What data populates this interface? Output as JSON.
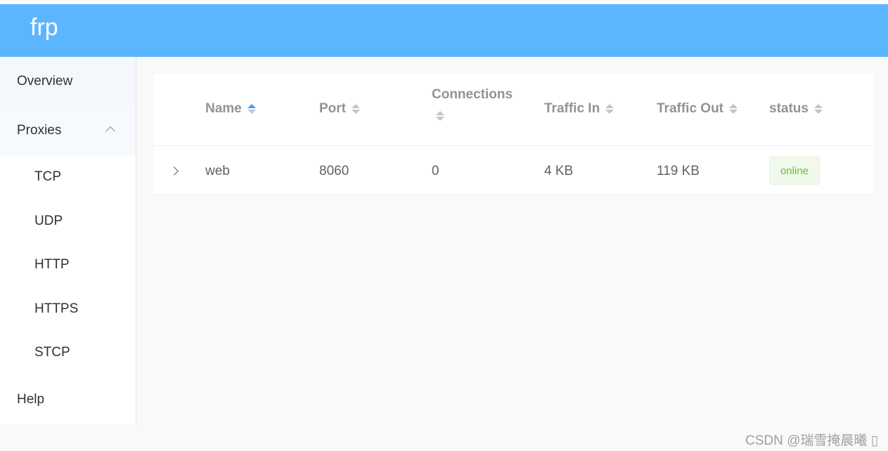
{
  "app": {
    "brand": "frp"
  },
  "sidebar": {
    "overview": "Overview",
    "proxies": "Proxies",
    "submenu": [
      "TCP",
      "UDP",
      "HTTP",
      "HTTPS",
      "STCP"
    ],
    "help": "Help"
  },
  "table": {
    "columns": {
      "name": "Name",
      "port": "Port",
      "connections": "Connections",
      "traffic_in": "Traffic In",
      "traffic_out": "Traffic Out",
      "status": "status"
    },
    "rows": [
      {
        "name": "web",
        "port": "8060",
        "connections": "0",
        "traffic_in": "4 KB",
        "traffic_out": "119 KB",
        "status": "online"
      }
    ]
  },
  "watermark": "CSDN @瑞雪掩晨曦 ▯",
  "colors": {
    "header": "#5cb6ff",
    "accent": "#409eff",
    "online": "#67c23a"
  },
  "icons": {
    "expand": "chevron-right-icon",
    "collapse": "chevron-up-icon",
    "sort": "sort-caret-icon"
  }
}
